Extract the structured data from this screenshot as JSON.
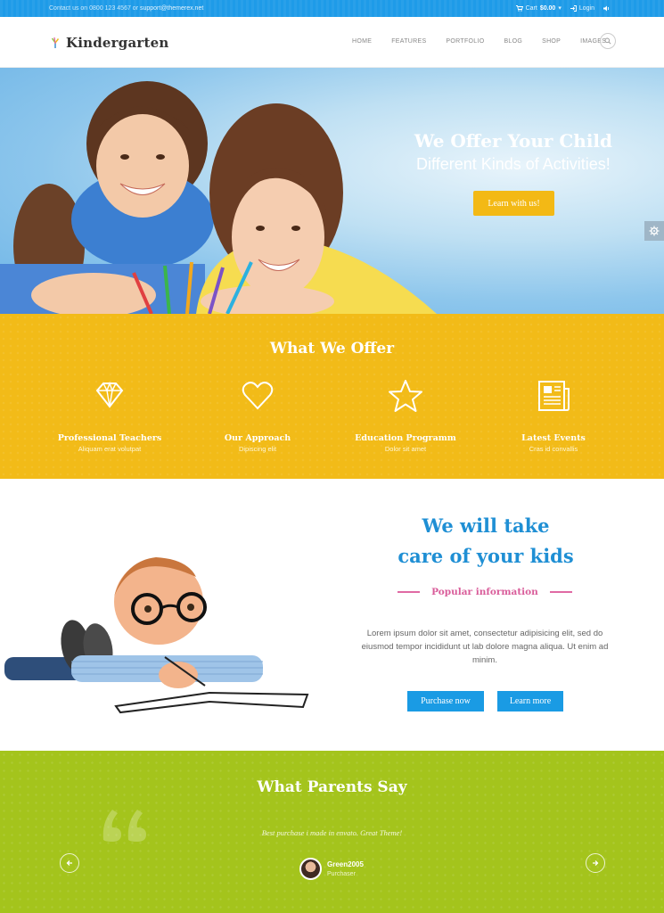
{
  "topbar": {
    "contact_prefix": "Contact us on 0800 123 4567 or ",
    "email": "support@themerex.net",
    "cart_label": "Cart",
    "cart_amount": "$0.00",
    "login_label": "Login"
  },
  "header": {
    "logo_text": "Kindergarten",
    "nav": [
      "HOME",
      "FEATURES",
      "PORTFOLIO",
      "BLOG",
      "SHOP",
      "IMAGES"
    ]
  },
  "hero": {
    "title": "We Offer Your Child",
    "subtitle": "Different Kinds of Activities!",
    "button": "Learn with us!"
  },
  "offer": {
    "title": "What We Offer",
    "items": [
      {
        "title": "Professional Teachers",
        "subtitle": "Aliquam erat volutpat",
        "icon": "diamond-icon"
      },
      {
        "title": "Our Approach",
        "subtitle": "Dipiscing elit",
        "icon": "heart-icon"
      },
      {
        "title": "Education Programm",
        "subtitle": "Dolor sit amet",
        "icon": "star-icon"
      },
      {
        "title": "Latest Events",
        "subtitle": "Cras id convallis",
        "icon": "newspaper-icon"
      }
    ]
  },
  "care": {
    "title_line1": "We will take",
    "title_line2": "care of your kids",
    "subtitle": "Popular information",
    "paragraph": "Lorem ipsum dolor sit amet, consectetur adipisicing elit, sed do eiusmod tempor incididunt ut lab dolore magna aliqua. Ut enim ad minim.",
    "button_primary": "Purchase now",
    "button_secondary": "Learn more"
  },
  "parents": {
    "title": "What Parents Say",
    "quote": "Best purchase i made in envato. Great Theme!",
    "author_name": "Green2005",
    "author_role": "Purchaser"
  },
  "colors": {
    "topbar": "#1e9be8",
    "yellow": "#f2bb18",
    "blue": "#1a9be4",
    "pink": "#d95c9a",
    "green": "#a4c41c"
  }
}
